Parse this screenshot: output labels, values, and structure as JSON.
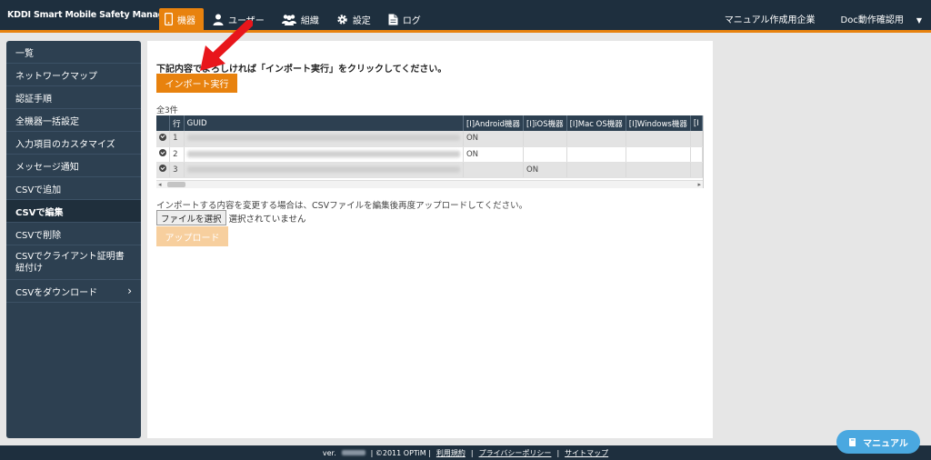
{
  "header": {
    "brand": "KDDI Smart Mobile Safety Manager",
    "nav": [
      {
        "label": "機器",
        "icon": "phone-icon",
        "active": true
      },
      {
        "label": "ユーザー",
        "icon": "user-icon",
        "active": false
      },
      {
        "label": "組織",
        "icon": "group-icon",
        "active": false
      },
      {
        "label": "設定",
        "icon": "gear-icon",
        "active": false
      },
      {
        "label": "ログ",
        "icon": "document-icon",
        "active": false
      }
    ],
    "company": "マニュアル作成用企業",
    "user": "Doc動作確認用"
  },
  "sidebar": {
    "items": [
      {
        "label": "一覧"
      },
      {
        "label": "ネットワークマップ"
      },
      {
        "label": "認証手順"
      },
      {
        "label": "全機器一括設定"
      },
      {
        "label": "入力項目のカスタマイズ"
      },
      {
        "label": "メッセージ通知"
      },
      {
        "label": "CSVで追加"
      },
      {
        "label": "CSVで編集",
        "active": true
      },
      {
        "label": "CSVで削除"
      },
      {
        "label": "CSVでクライアント証明書紐付け"
      },
      {
        "label": "CSVをダウンロード",
        "chevron": true
      }
    ]
  },
  "main": {
    "instruction": "下記内容でよろしければ「インポート実行」をクリックしてください。",
    "import_button": "インポート実行",
    "count": "全3件",
    "table": {
      "headers": [
        "",
        "行",
        "GUID",
        "[I]Android機器",
        "[I]iOS機器",
        "[I]Mac OS機器",
        "[I]Windows機器",
        "[I"
      ],
      "rows": [
        {
          "row": "1",
          "android": "ON",
          "ios": "",
          "mac": "",
          "windows": ""
        },
        {
          "row": "2",
          "android": "ON",
          "ios": "",
          "mac": "",
          "windows": ""
        },
        {
          "row": "3",
          "android": "",
          "ios": "ON",
          "mac": "",
          "windows": ""
        }
      ]
    },
    "note": "インポートする内容を変更する場合は、CSVファイルを編集後再度アップロードしてください。",
    "file_button": "ファイルを選択",
    "file_status": "選択されていません",
    "upload_button": "アップロード"
  },
  "footer": {
    "ver": "ver.",
    "copyright": "| ©2011 OPTiM |",
    "terms": "利用規約",
    "privacy": "プライバシーポリシー",
    "sitemap": "サイトマップ",
    "sep": "|"
  },
  "manual_button": "マニュアル",
  "colors": {
    "accent": "#e8820e",
    "header": "#1e2f3e",
    "sidebar": "#2d4051",
    "manual": "#4aa8e0",
    "arrow": "#e8161b"
  }
}
